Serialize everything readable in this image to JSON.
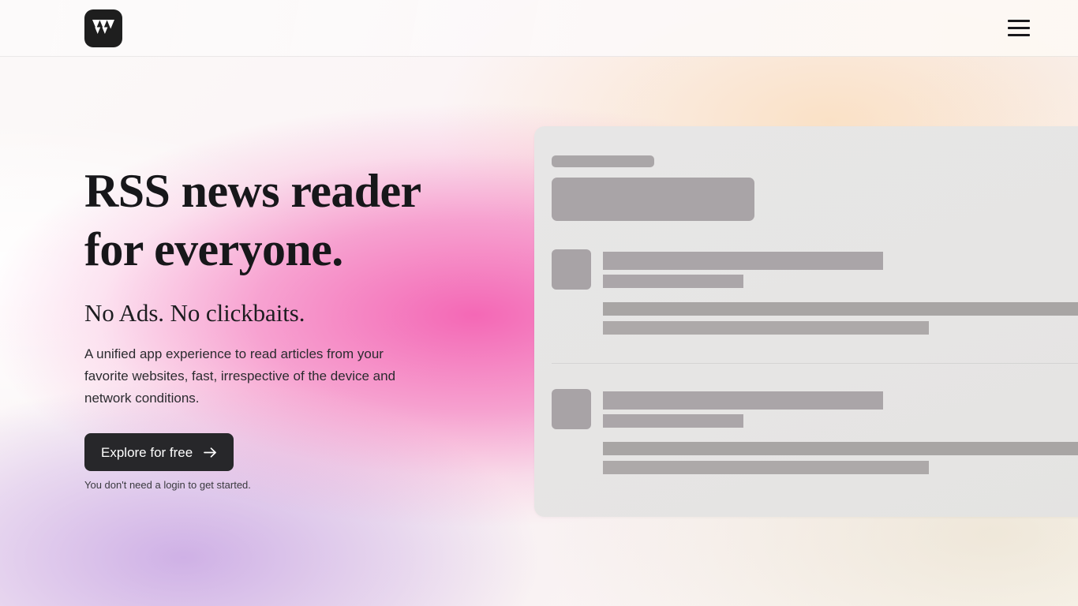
{
  "header": {
    "logo_icon": "w-logo-icon",
    "logo_alt": "W",
    "menu_icon": "hamburger-menu-icon",
    "menu_label": "Menu"
  },
  "hero": {
    "headline": "RSS news reader\nfor everyone.",
    "subheadline": "No Ads. No clickbaits.",
    "description": "A unified app experience to read articles from your favorite websites, fast, irrespective of the device and network conditions.",
    "cta_label": "Explore for free",
    "cta_arrow_icon": "arrow-right-icon",
    "cta_note": "You don't need a login to get started."
  },
  "preview": {
    "label": "loading-skeleton-preview",
    "rows": [
      {
        "label": "skeleton-article-1"
      },
      {
        "label": "skeleton-article-2"
      }
    ]
  },
  "colors": {
    "ink": "#17171a",
    "button_bg": "#27272a",
    "button_text": "#ffffff",
    "accent_pink": "#f35cb0",
    "accent_lavender": "#c4a0e2",
    "accent_peach": "#fad6aa",
    "card_bg": "#e7e6e6",
    "skeleton_bar": "#aaa6a8"
  }
}
